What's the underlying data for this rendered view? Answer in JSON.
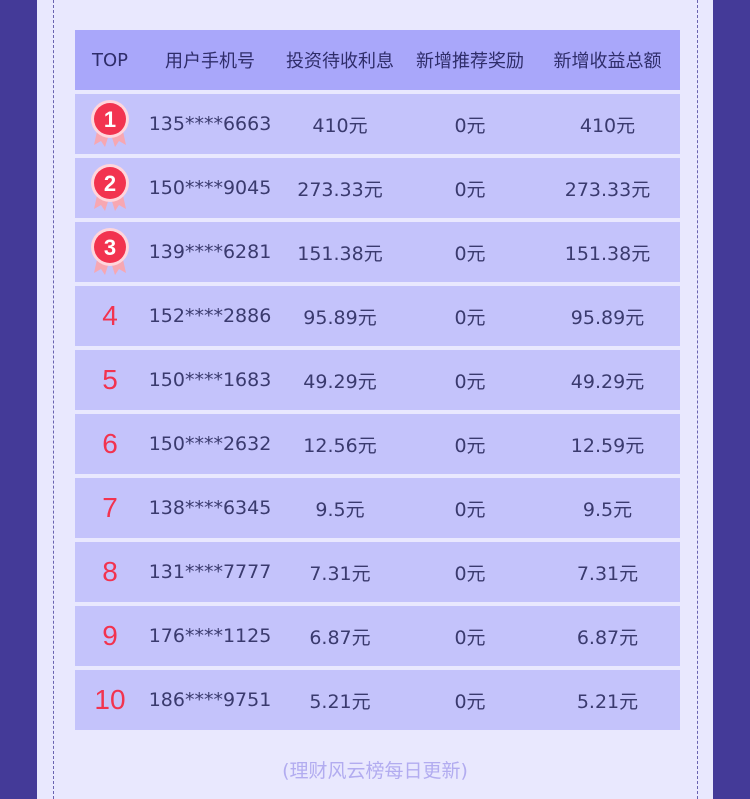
{
  "header": {
    "top": "TOP",
    "phone": "用户手机号",
    "interest": "投资待收利息",
    "referral": "新增推荐奖励",
    "total": "新增收益总额"
  },
  "rows": [
    {
      "rank": "1",
      "phone": "135****6663",
      "interest": "410元",
      "referral": "0元",
      "total": "410元"
    },
    {
      "rank": "2",
      "phone": "150****9045",
      "interest": "273.33元",
      "referral": "0元",
      "total": "273.33元"
    },
    {
      "rank": "3",
      "phone": "139****6281",
      "interest": "151.38元",
      "referral": "0元",
      "total": "151.38元"
    },
    {
      "rank": "4",
      "phone": "152****2886",
      "interest": "95.89元",
      "referral": "0元",
      "total": "95.89元"
    },
    {
      "rank": "5",
      "phone": "150****1683",
      "interest": "49.29元",
      "referral": "0元",
      "total": "49.29元"
    },
    {
      "rank": "6",
      "phone": "150****2632",
      "interest": "12.56元",
      "referral": "0元",
      "total": "12.59元"
    },
    {
      "rank": "7",
      "phone": "138****6345",
      "interest": "9.5元",
      "referral": "0元",
      "total": "9.5元"
    },
    {
      "rank": "8",
      "phone": "131****7777",
      "interest": "7.31元",
      "referral": "0元",
      "total": "7.31元"
    },
    {
      "rank": "9",
      "phone": "176****1125",
      "interest": "6.87元",
      "referral": "0元",
      "total": "6.87元"
    },
    {
      "rank": "10",
      "phone": "186****9751",
      "interest": "5.21元",
      "referral": "0元",
      "total": "5.21元"
    }
  ],
  "footer": "(理财风云榜每日更新)",
  "colors": {
    "background": "#443a98",
    "panel": "#e9e8fe",
    "header_row": "#a9a7fa",
    "body_row": "#c4c3fb",
    "rank_red": "#f2334f"
  },
  "icons": {
    "medal": "award-ribbon-medal-icon"
  }
}
